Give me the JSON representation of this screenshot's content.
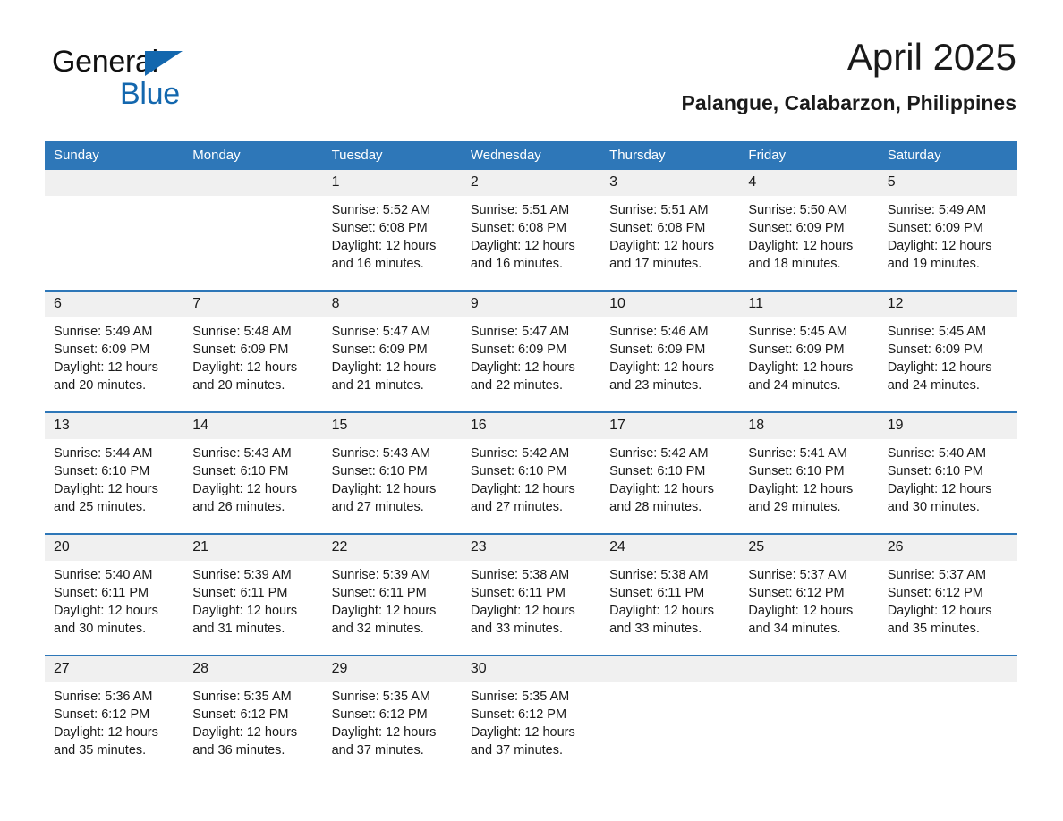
{
  "brand": {
    "name_part1": "General",
    "name_part2": "Blue",
    "triangle_color": "#1367ae"
  },
  "header": {
    "title": "April 2025",
    "subtitle": "Palangue, Calabarzon, Philippines",
    "accent_color": "#2e77b8",
    "daynum_band_color": "#f0f0f0"
  },
  "weekday_headers": [
    "Sunday",
    "Monday",
    "Tuesday",
    "Wednesday",
    "Thursday",
    "Friday",
    "Saturday"
  ],
  "labels": {
    "sunrise_prefix": "Sunrise:",
    "sunset_prefix": "Sunset:",
    "daylight_prefix": "Daylight:"
  },
  "weeks": [
    {
      "days": [
        {
          "num": "",
          "sunrise": "",
          "sunset": "",
          "daylight_line1": "",
          "daylight_line2": ""
        },
        {
          "num": "",
          "sunrise": "",
          "sunset": "",
          "daylight_line1": "",
          "daylight_line2": ""
        },
        {
          "num": "1",
          "sunrise": "Sunrise: 5:52 AM",
          "sunset": "Sunset: 6:08 PM",
          "daylight_line1": "Daylight: 12 hours",
          "daylight_line2": "and 16 minutes."
        },
        {
          "num": "2",
          "sunrise": "Sunrise: 5:51 AM",
          "sunset": "Sunset: 6:08 PM",
          "daylight_line1": "Daylight: 12 hours",
          "daylight_line2": "and 16 minutes."
        },
        {
          "num": "3",
          "sunrise": "Sunrise: 5:51 AM",
          "sunset": "Sunset: 6:08 PM",
          "daylight_line1": "Daylight: 12 hours",
          "daylight_line2": "and 17 minutes."
        },
        {
          "num": "4",
          "sunrise": "Sunrise: 5:50 AM",
          "sunset": "Sunset: 6:09 PM",
          "daylight_line1": "Daylight: 12 hours",
          "daylight_line2": "and 18 minutes."
        },
        {
          "num": "5",
          "sunrise": "Sunrise: 5:49 AM",
          "sunset": "Sunset: 6:09 PM",
          "daylight_line1": "Daylight: 12 hours",
          "daylight_line2": "and 19 minutes."
        }
      ]
    },
    {
      "days": [
        {
          "num": "6",
          "sunrise": "Sunrise: 5:49 AM",
          "sunset": "Sunset: 6:09 PM",
          "daylight_line1": "Daylight: 12 hours",
          "daylight_line2": "and 20 minutes."
        },
        {
          "num": "7",
          "sunrise": "Sunrise: 5:48 AM",
          "sunset": "Sunset: 6:09 PM",
          "daylight_line1": "Daylight: 12 hours",
          "daylight_line2": "and 20 minutes."
        },
        {
          "num": "8",
          "sunrise": "Sunrise: 5:47 AM",
          "sunset": "Sunset: 6:09 PM",
          "daylight_line1": "Daylight: 12 hours",
          "daylight_line2": "and 21 minutes."
        },
        {
          "num": "9",
          "sunrise": "Sunrise: 5:47 AM",
          "sunset": "Sunset: 6:09 PM",
          "daylight_line1": "Daylight: 12 hours",
          "daylight_line2": "and 22 minutes."
        },
        {
          "num": "10",
          "sunrise": "Sunrise: 5:46 AM",
          "sunset": "Sunset: 6:09 PM",
          "daylight_line1": "Daylight: 12 hours",
          "daylight_line2": "and 23 minutes."
        },
        {
          "num": "11",
          "sunrise": "Sunrise: 5:45 AM",
          "sunset": "Sunset: 6:09 PM",
          "daylight_line1": "Daylight: 12 hours",
          "daylight_line2": "and 24 minutes."
        },
        {
          "num": "12",
          "sunrise": "Sunrise: 5:45 AM",
          "sunset": "Sunset: 6:09 PM",
          "daylight_line1": "Daylight: 12 hours",
          "daylight_line2": "and 24 minutes."
        }
      ]
    },
    {
      "days": [
        {
          "num": "13",
          "sunrise": "Sunrise: 5:44 AM",
          "sunset": "Sunset: 6:10 PM",
          "daylight_line1": "Daylight: 12 hours",
          "daylight_line2": "and 25 minutes."
        },
        {
          "num": "14",
          "sunrise": "Sunrise: 5:43 AM",
          "sunset": "Sunset: 6:10 PM",
          "daylight_line1": "Daylight: 12 hours",
          "daylight_line2": "and 26 minutes."
        },
        {
          "num": "15",
          "sunrise": "Sunrise: 5:43 AM",
          "sunset": "Sunset: 6:10 PM",
          "daylight_line1": "Daylight: 12 hours",
          "daylight_line2": "and 27 minutes."
        },
        {
          "num": "16",
          "sunrise": "Sunrise: 5:42 AM",
          "sunset": "Sunset: 6:10 PM",
          "daylight_line1": "Daylight: 12 hours",
          "daylight_line2": "and 27 minutes."
        },
        {
          "num": "17",
          "sunrise": "Sunrise: 5:42 AM",
          "sunset": "Sunset: 6:10 PM",
          "daylight_line1": "Daylight: 12 hours",
          "daylight_line2": "and 28 minutes."
        },
        {
          "num": "18",
          "sunrise": "Sunrise: 5:41 AM",
          "sunset": "Sunset: 6:10 PM",
          "daylight_line1": "Daylight: 12 hours",
          "daylight_line2": "and 29 minutes."
        },
        {
          "num": "19",
          "sunrise": "Sunrise: 5:40 AM",
          "sunset": "Sunset: 6:10 PM",
          "daylight_line1": "Daylight: 12 hours",
          "daylight_line2": "and 30 minutes."
        }
      ]
    },
    {
      "days": [
        {
          "num": "20",
          "sunrise": "Sunrise: 5:40 AM",
          "sunset": "Sunset: 6:11 PM",
          "daylight_line1": "Daylight: 12 hours",
          "daylight_line2": "and 30 minutes."
        },
        {
          "num": "21",
          "sunrise": "Sunrise: 5:39 AM",
          "sunset": "Sunset: 6:11 PM",
          "daylight_line1": "Daylight: 12 hours",
          "daylight_line2": "and 31 minutes."
        },
        {
          "num": "22",
          "sunrise": "Sunrise: 5:39 AM",
          "sunset": "Sunset: 6:11 PM",
          "daylight_line1": "Daylight: 12 hours",
          "daylight_line2": "and 32 minutes."
        },
        {
          "num": "23",
          "sunrise": "Sunrise: 5:38 AM",
          "sunset": "Sunset: 6:11 PM",
          "daylight_line1": "Daylight: 12 hours",
          "daylight_line2": "and 33 minutes."
        },
        {
          "num": "24",
          "sunrise": "Sunrise: 5:38 AM",
          "sunset": "Sunset: 6:11 PM",
          "daylight_line1": "Daylight: 12 hours",
          "daylight_line2": "and 33 minutes."
        },
        {
          "num": "25",
          "sunrise": "Sunrise: 5:37 AM",
          "sunset": "Sunset: 6:12 PM",
          "daylight_line1": "Daylight: 12 hours",
          "daylight_line2": "and 34 minutes."
        },
        {
          "num": "26",
          "sunrise": "Sunrise: 5:37 AM",
          "sunset": "Sunset: 6:12 PM",
          "daylight_line1": "Daylight: 12 hours",
          "daylight_line2": "and 35 minutes."
        }
      ]
    },
    {
      "days": [
        {
          "num": "27",
          "sunrise": "Sunrise: 5:36 AM",
          "sunset": "Sunset: 6:12 PM",
          "daylight_line1": "Daylight: 12 hours",
          "daylight_line2": "and 35 minutes."
        },
        {
          "num": "28",
          "sunrise": "Sunrise: 5:35 AM",
          "sunset": "Sunset: 6:12 PM",
          "daylight_line1": "Daylight: 12 hours",
          "daylight_line2": "and 36 minutes."
        },
        {
          "num": "29",
          "sunrise": "Sunrise: 5:35 AM",
          "sunset": "Sunset: 6:12 PM",
          "daylight_line1": "Daylight: 12 hours",
          "daylight_line2": "and 37 minutes."
        },
        {
          "num": "30",
          "sunrise": "Sunrise: 5:35 AM",
          "sunset": "Sunset: 6:12 PM",
          "daylight_line1": "Daylight: 12 hours",
          "daylight_line2": "and 37 minutes."
        },
        {
          "num": "",
          "sunrise": "",
          "sunset": "",
          "daylight_line1": "",
          "daylight_line2": ""
        },
        {
          "num": "",
          "sunrise": "",
          "sunset": "",
          "daylight_line1": "",
          "daylight_line2": ""
        },
        {
          "num": "",
          "sunrise": "",
          "sunset": "",
          "daylight_line1": "",
          "daylight_line2": ""
        }
      ]
    }
  ]
}
